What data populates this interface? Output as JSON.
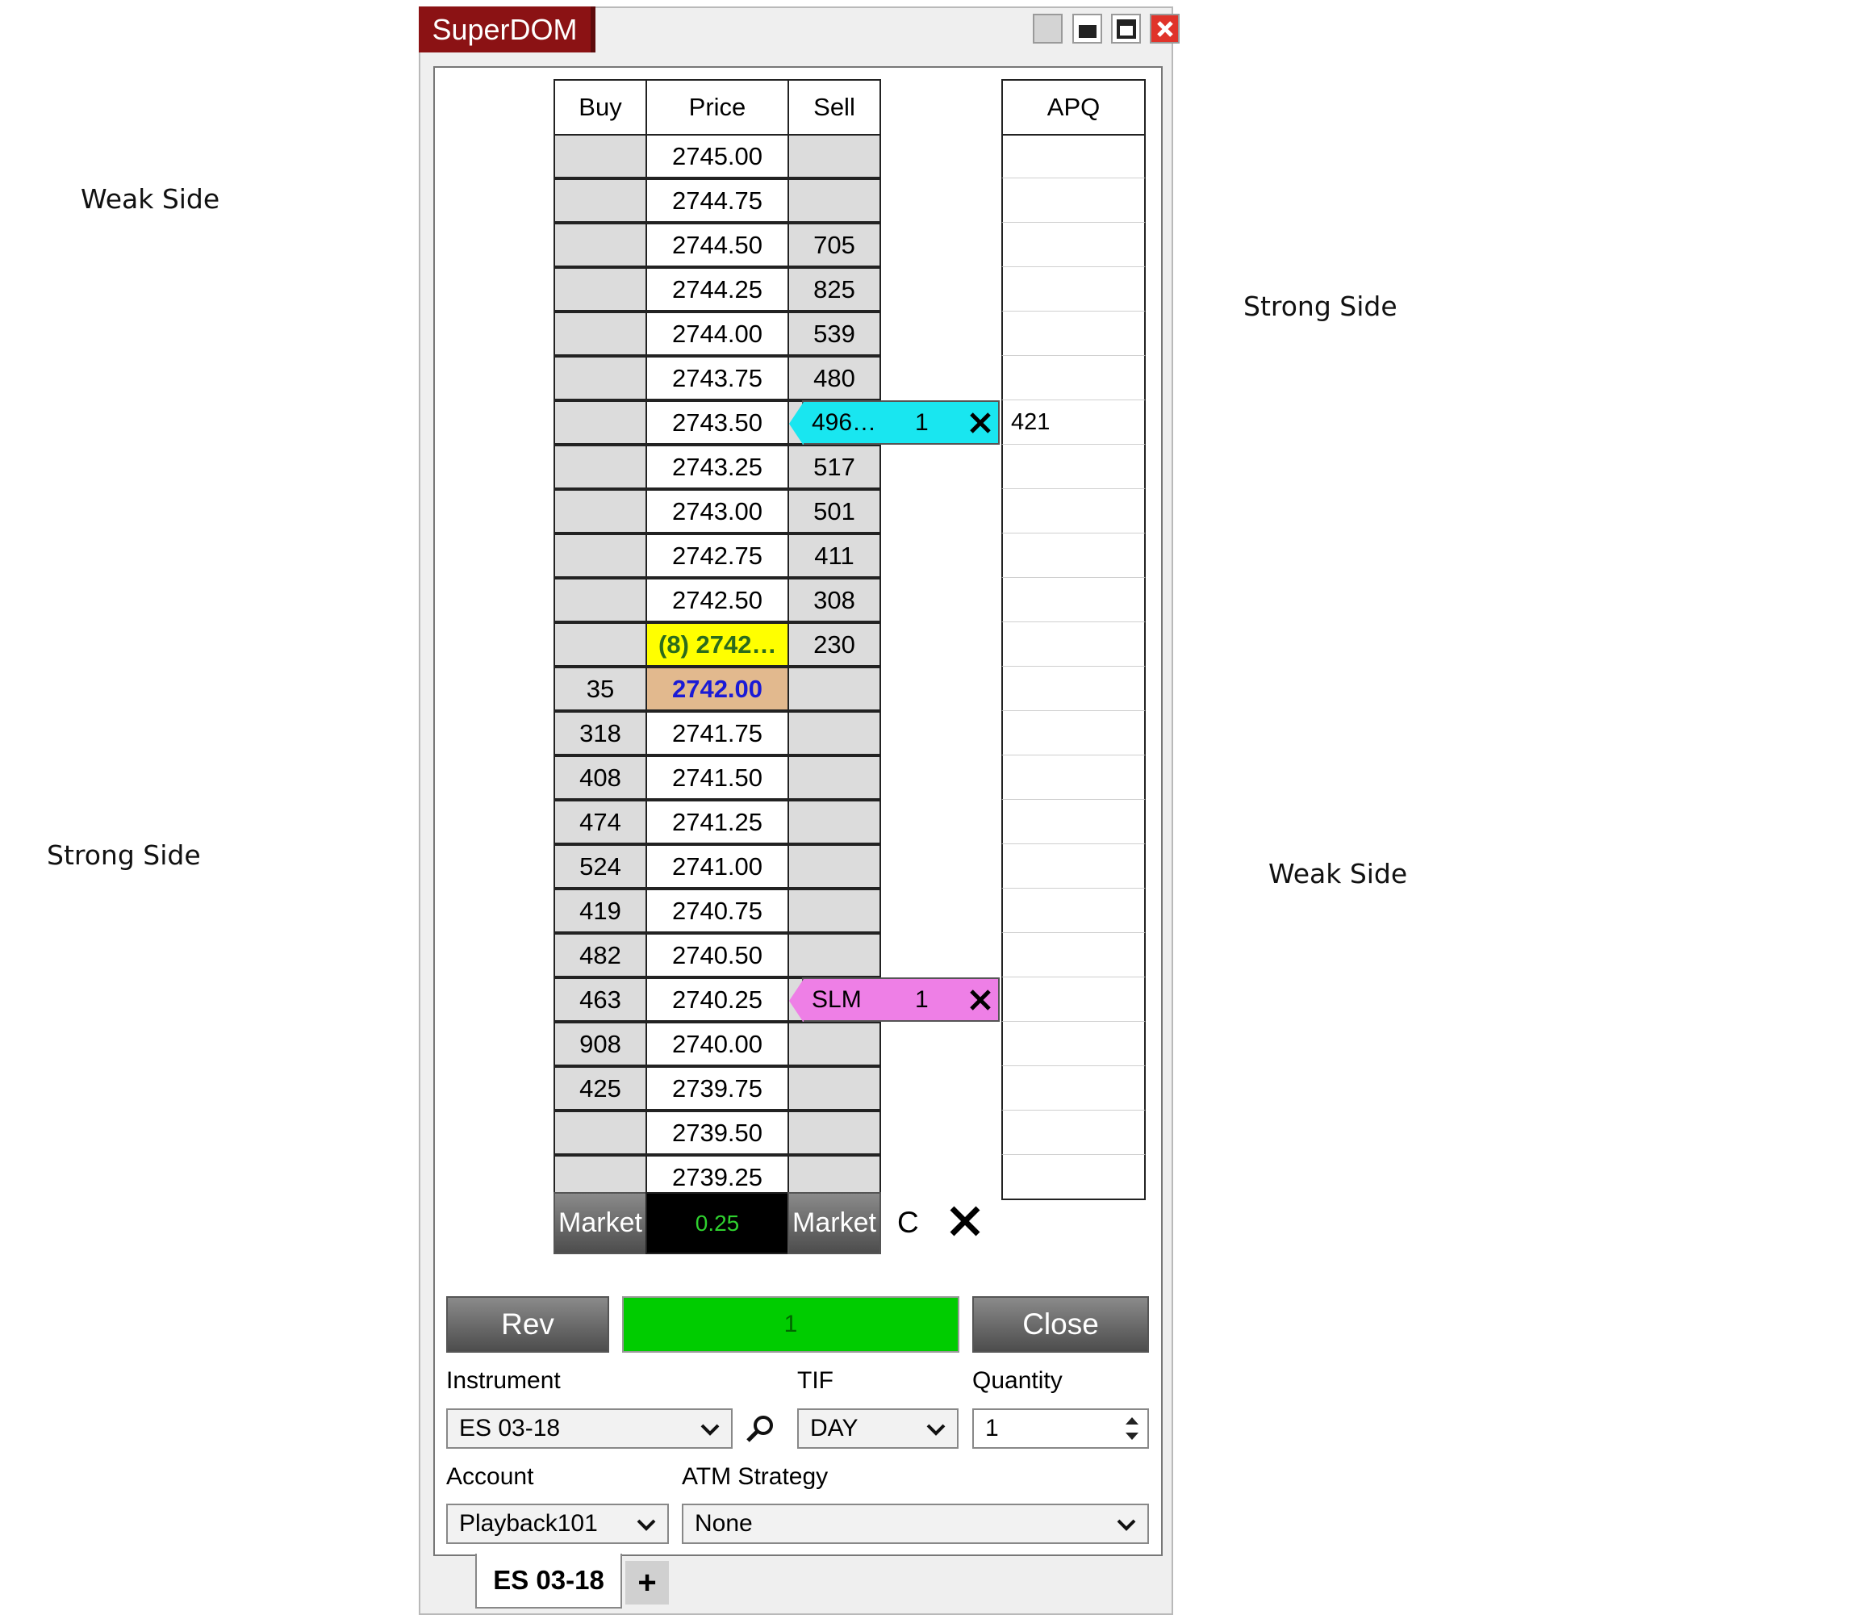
{
  "annotations": {
    "left_top": "Weak Side",
    "left_bottom": "Strong Side",
    "right_top": "Strong Side",
    "right_bottom": "Weak Side"
  },
  "window": {
    "title": "SuperDOM"
  },
  "dom": {
    "headers": {
      "buy": "Buy",
      "price": "Price",
      "sell": "Sell",
      "apq": "APQ"
    },
    "rows": [
      {
        "buy": "",
        "price": "2745.00",
        "sell": "",
        "apq": ""
      },
      {
        "buy": "",
        "price": "2744.75",
        "sell": "",
        "apq": ""
      },
      {
        "buy": "",
        "price": "2744.50",
        "sell": "705",
        "apq": ""
      },
      {
        "buy": "",
        "price": "2744.25",
        "sell": "825",
        "apq": ""
      },
      {
        "buy": "",
        "price": "2744.00",
        "sell": "539",
        "apq": ""
      },
      {
        "buy": "",
        "price": "2743.75",
        "sell": "480",
        "apq": ""
      },
      {
        "buy": "",
        "price": "2743.50",
        "sell": "",
        "apq": "421"
      },
      {
        "buy": "",
        "price": "2743.25",
        "sell": "517",
        "apq": ""
      },
      {
        "buy": "",
        "price": "2743.00",
        "sell": "501",
        "apq": ""
      },
      {
        "buy": "",
        "price": "2742.75",
        "sell": "411",
        "apq": ""
      },
      {
        "buy": "",
        "price": "2742.50",
        "sell": "308",
        "apq": ""
      },
      {
        "buy": "",
        "price": "(8) 2742…",
        "sell": "230",
        "apq": ""
      },
      {
        "buy": "35",
        "price": "2742.00",
        "sell": "",
        "apq": ""
      },
      {
        "buy": "318",
        "price": "2741.75",
        "sell": "",
        "apq": ""
      },
      {
        "buy": "408",
        "price": "2741.50",
        "sell": "",
        "apq": ""
      },
      {
        "buy": "474",
        "price": "2741.25",
        "sell": "",
        "apq": ""
      },
      {
        "buy": "524",
        "price": "2741.00",
        "sell": "",
        "apq": ""
      },
      {
        "buy": "419",
        "price": "2740.75",
        "sell": "",
        "apq": ""
      },
      {
        "buy": "482",
        "price": "2740.50",
        "sell": "",
        "apq": ""
      },
      {
        "buy": "463",
        "price": "2740.25",
        "sell": "",
        "apq": ""
      },
      {
        "buy": "908",
        "price": "2740.00",
        "sell": "",
        "apq": ""
      },
      {
        "buy": "425",
        "price": "2739.75",
        "sell": "",
        "apq": ""
      },
      {
        "buy": "",
        "price": "2739.50",
        "sell": "",
        "apq": ""
      },
      {
        "buy": "",
        "price": "2739.25",
        "sell": "",
        "apq": ""
      }
    ],
    "highlight_last_row": 11,
    "highlight_bid_row": 12,
    "orders": [
      {
        "row": 6,
        "label": "496…",
        "qty": "1",
        "color": "#19e6f0"
      },
      {
        "row": 19,
        "label": "SLM",
        "qty": "1",
        "color": "#ee7fe6"
      }
    ],
    "bottom": {
      "market_buy": "Market",
      "tick_size": "0.25",
      "market_sell": "Market",
      "cancel_label": "C"
    }
  },
  "controls": {
    "rev_label": "Rev",
    "position_qty": "1",
    "close_label": "Close",
    "instrument_label": "Instrument",
    "instrument_value": "ES 03-18",
    "tif_label": "TIF",
    "tif_value": "DAY",
    "quantity_label": "Quantity",
    "quantity_value": "1",
    "account_label": "Account",
    "account_value": "Playback101",
    "atm_label": "ATM Strategy",
    "atm_value": "None"
  },
  "tabs": {
    "active": "ES 03-18",
    "add_label": "+"
  },
  "colors": {
    "title_bg": "#8b1214",
    "last_price_bg": "#ffff00",
    "bid_price_bg": "#e2b98e",
    "position_green": "#00cc00"
  }
}
